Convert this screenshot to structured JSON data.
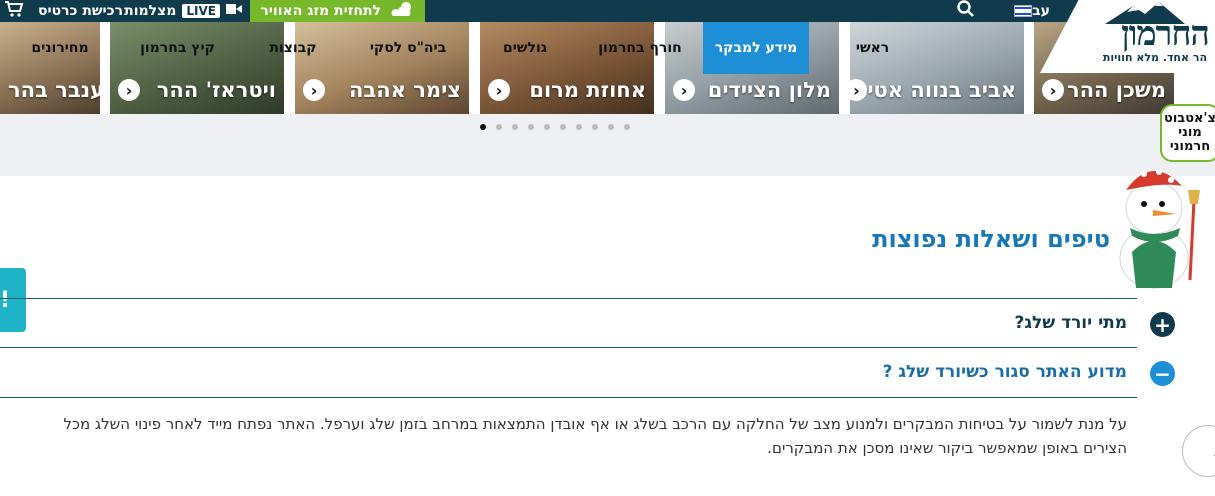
{
  "topbar": {
    "cart_label": "רכישת כרטיס",
    "cams_label": "מצלמות",
    "live_label": "LIVE",
    "weather_label": "לתחזית מזג האוויר",
    "lang_label": "עב"
  },
  "logo": {
    "name": "החרמון",
    "tagline": "הר אחד. מלא חוויות"
  },
  "nav": {
    "items": [
      {
        "label": "ראשי"
      },
      {
        "label": "מידע למבקר",
        "active": true
      },
      {
        "label": "חורף בחרמון"
      },
      {
        "label": "גולשים"
      },
      {
        "label": "ביה\"ס לסקי"
      },
      {
        "label": "קבוצות"
      },
      {
        "label": "קיץ בחרמון"
      },
      {
        "label": "מחירונים"
      }
    ]
  },
  "slider": {
    "cards": [
      {
        "title": "משכן ההר"
      },
      {
        "title": "אביב בנווה אטי"
      },
      {
        "title": "מלון הציידים"
      },
      {
        "title": "אחוזת מרום"
      },
      {
        "title": "צימר אהבה"
      },
      {
        "title": "ויטראז' ההר"
      },
      {
        "title": "ענבר בהר"
      }
    ],
    "dots_total": 10,
    "active_dot": 0
  },
  "faq": {
    "title": "טיפים ושאלות נפוצות",
    "questions": [
      {
        "q": "מתי יורד שלג?",
        "open": false
      },
      {
        "q": "מדוע האתר סגור כשיורד שלג ?",
        "open": true
      }
    ],
    "answer": "על מנת לשמור על בטיחות המבקרים ולמנוע מצב של החלקה עם הרכב בשלג או אף אובדן התמצאות במרחב בזמן שלג וערפל. האתר נפתח מייד לאחר פינוי השלג מכל הצירים באופן שמאפשר ביקור שאינו מסכן את המבקרים."
  },
  "chatbot": {
    "bubble_line1": "צ'אטבוט",
    "bubble_line2": "מוני",
    "bubble_line3": "חרמוני"
  },
  "colors": {
    "dark": "#0f3b4d",
    "accent_blue": "#1e8ed6",
    "green": "#77b82a",
    "teal": "#1eb3c6"
  }
}
